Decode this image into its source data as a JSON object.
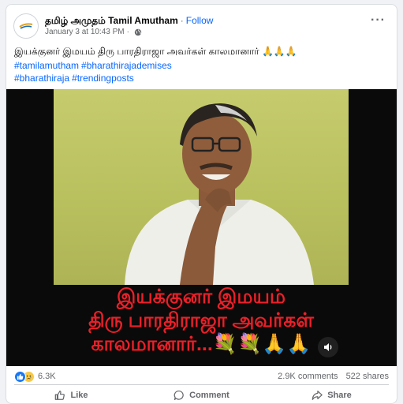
{
  "post": {
    "author": "தமிழ் அமுதம் Tamil Amutham",
    "separator": "·",
    "follow_label": "Follow",
    "timestamp": "January 3 at 10:43 PM",
    "timestamp_separator": "·",
    "more_label": "···",
    "caption": "இயக்குனர் இமயம் திரு பாரதிராஜா அவர்கள் காலமானார் 🙏🙏🙏",
    "hashtags": [
      "#tamilamutham",
      "#bharathirajademises",
      "#bharathiraja",
      "#trendingposts"
    ]
  },
  "media": {
    "overlay_lines": [
      "இயக்குனர் இமயம்",
      "திரு பாரதிராஜா அவர்கள்",
      "காலமானார்..."
    ],
    "overlay_emojis": "💐💐🙏🙏"
  },
  "stats": {
    "reaction_count": "6.3K",
    "comments": "2.9K comments",
    "shares": "522 shares"
  },
  "actions": {
    "like": "Like",
    "comment": "Comment",
    "share": "Share"
  },
  "colors": {
    "link_blue": "#0866ff",
    "overlay_red": "#e8212a",
    "like_blue": "#1877f2",
    "photo_background": "#c6cc6e"
  }
}
